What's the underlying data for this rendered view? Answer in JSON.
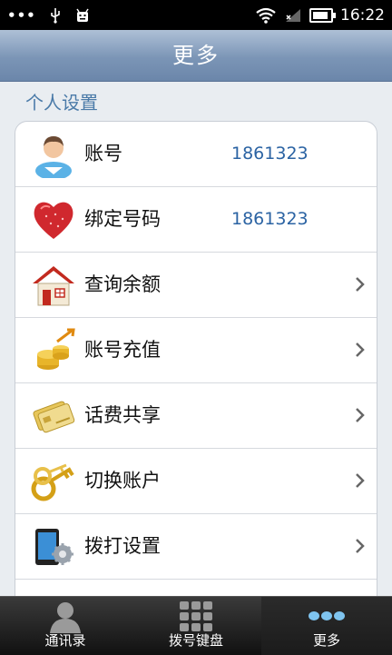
{
  "status_bar": {
    "menu_dots": "•••",
    "time": "16:22"
  },
  "header": {
    "title": "更多"
  },
  "section": {
    "title": "个人设置"
  },
  "rows": [
    {
      "label": "账号",
      "value": "1861323",
      "icon": "user-avatar-icon"
    },
    {
      "label": "绑定号码",
      "value": "1861323",
      "icon": "heart-icon"
    },
    {
      "label": "查询余额",
      "icon": "house-icon"
    },
    {
      "label": "账号充值",
      "icon": "coins-icon"
    },
    {
      "label": "话费共享",
      "icon": "cards-icon"
    },
    {
      "label": "切换账户",
      "icon": "keys-icon"
    },
    {
      "label": "拨打设置",
      "icon": "phone-settings-icon"
    }
  ],
  "tabs": [
    {
      "label": "通讯录",
      "icon": "contacts-icon"
    },
    {
      "label": "拨号键盘",
      "icon": "dialpad-icon"
    },
    {
      "label": "更多",
      "icon": "more-dots-icon",
      "active": true
    }
  ],
  "colors": {
    "header_blue": "#7b95b6",
    "value_blue": "#2b63a3",
    "section_blue": "#4a7aa8"
  }
}
